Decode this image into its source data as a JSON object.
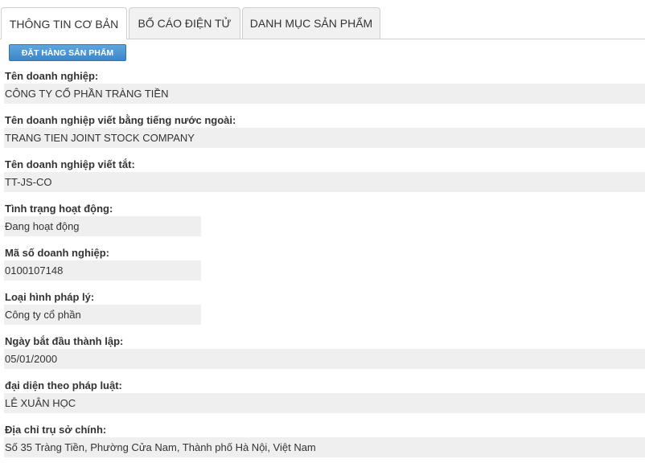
{
  "tabs": [
    {
      "label": "THÔNG TIN CƠ BẢN",
      "active": true
    },
    {
      "label": "BỐ CÁO ĐIỆN TỬ",
      "active": false
    },
    {
      "label": "DANH MỤC SẢN PHẨM",
      "active": false
    }
  ],
  "order_button": {
    "label": "ĐẶT HÀNG SẢN PHẨM",
    "color": "#3c86c8"
  },
  "fields": [
    {
      "label": "Tên doanh nghiệp:",
      "value": "CÔNG TY CỔ PHẦN TRÀNG TIỀN"
    },
    {
      "label": "Tên doanh nghiệp viết bằng tiếng nước ngoài:",
      "value": "TRANG TIEN JOINT STOCK COMPANY"
    },
    {
      "label": "Tên doanh nghiệp viết tắt:",
      "value": "TT-JS-CO"
    },
    {
      "label": "Tình trạng hoạt động:",
      "value": "Đang hoạt động"
    },
    {
      "label": "Mã số doanh nghiệp:",
      "value": "0100107148"
    },
    {
      "label": "Loại hình pháp lý:",
      "value": "Công ty cổ phần"
    },
    {
      "label": "Ngày bắt đầu thành lập:",
      "value": "05/01/2000"
    },
    {
      "label": "đại diện theo pháp luật:",
      "value": "LÊ XUÂN HỌC"
    },
    {
      "label": "Địa chỉ trụ sở chính:",
      "value": "Số 35 Tràng Tiền, Phường Cửa Nam, Thành phố Hà Nội, Việt Nam"
    }
  ]
}
